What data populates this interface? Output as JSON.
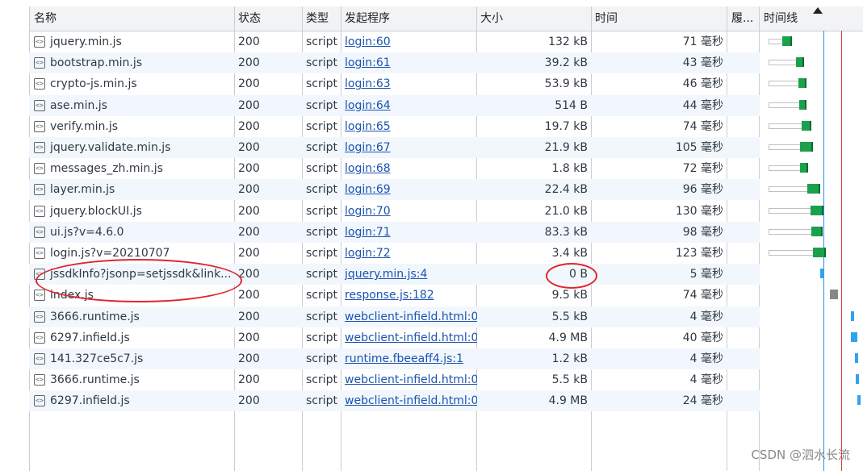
{
  "headers": {
    "name": "名称",
    "status": "状态",
    "type": "类型",
    "initiator": "发起程序",
    "size": "大小",
    "time": "时间",
    "waterfall_trunc": "履...",
    "timeline": "时间线"
  },
  "rows": [
    {
      "name": "jquery.min.js",
      "status": "200",
      "type": "script",
      "initiator": "login:60",
      "size": "132 kB",
      "time": "71  毫秒"
    },
    {
      "name": "bootstrap.min.js",
      "status": "200",
      "type": "script",
      "initiator": "login:61",
      "size": "39.2 kB",
      "time": "43  毫秒"
    },
    {
      "name": "crypto-js.min.js",
      "status": "200",
      "type": "script",
      "initiator": "login:63",
      "size": "53.9 kB",
      "time": "46  毫秒"
    },
    {
      "name": "ase.min.js",
      "status": "200",
      "type": "script",
      "initiator": "login:64",
      "size": "514 B",
      "time": "44  毫秒"
    },
    {
      "name": "verify.min.js",
      "status": "200",
      "type": "script",
      "initiator": "login:65",
      "size": "19.7 kB",
      "time": "74  毫秒"
    },
    {
      "name": "jquery.validate.min.js",
      "status": "200",
      "type": "script",
      "initiator": "login:67",
      "size": "21.9 kB",
      "time": "105  毫秒"
    },
    {
      "name": "messages_zh.min.js",
      "status": "200",
      "type": "script",
      "initiator": "login:68",
      "size": "1.8 kB",
      "time": "72  毫秒"
    },
    {
      "name": "layer.min.js",
      "status": "200",
      "type": "script",
      "initiator": "login:69",
      "size": "22.4 kB",
      "time": "96  毫秒"
    },
    {
      "name": "jquery.blockUI.js",
      "status": "200",
      "type": "script",
      "initiator": "login:70",
      "size": "21.0 kB",
      "time": "130  毫秒"
    },
    {
      "name": "ui.js?v=4.6.0",
      "status": "200",
      "type": "script",
      "initiator": "login:71",
      "size": "83.3 kB",
      "time": "98  毫秒"
    },
    {
      "name": "login.js?v=20210707",
      "status": "200",
      "type": "script",
      "initiator": "login:72",
      "size": "3.4 kB",
      "time": "123  毫秒"
    },
    {
      "name": "jssdkInfo?jsonp=setjssdk&link...",
      "status": "200",
      "type": "script",
      "initiator": "jquery.min.js:4",
      "size": "0 B",
      "time": "5  毫秒"
    },
    {
      "name": "index.js",
      "status": "200",
      "type": "script",
      "initiator": "response.js:182",
      "size": "9.5 kB",
      "time": "74  毫秒"
    },
    {
      "name": "3666.runtime.js",
      "status": "200",
      "type": "script",
      "initiator": "webclient-infield.html:0",
      "size": "5.5 kB",
      "time": "4  毫秒"
    },
    {
      "name": "6297.infield.js",
      "status": "200",
      "type": "script",
      "initiator": "webclient-infield.html:0",
      "size": "4.9 MB",
      "time": "40  毫秒"
    },
    {
      "name": "141.327ce5c7.js",
      "status": "200",
      "type": "script",
      "initiator": "runtime.fbeeaff4.js:1",
      "size": "1.2 kB",
      "time": "4  毫秒"
    },
    {
      "name": "3666.runtime.js",
      "status": "200",
      "type": "script",
      "initiator": "webclient-infield.html:0",
      "size": "5.5 kB",
      "time": "4  毫秒"
    },
    {
      "name": "6297.infield.js",
      "status": "200",
      "type": "script",
      "initiator": "webclient-infield.html:0",
      "size": "4.9 MB",
      "time": "24  毫秒"
    }
  ],
  "watermark": "CSDN @泗水长流",
  "icons": {
    "file": "script-file-icon",
    "sort": "sort-ascending-icon"
  },
  "colors": {
    "link": "#1a53b0",
    "stripe": "#f2f7fd",
    "dl_bar": "#1aa14c",
    "annotation": "#e0262f"
  }
}
